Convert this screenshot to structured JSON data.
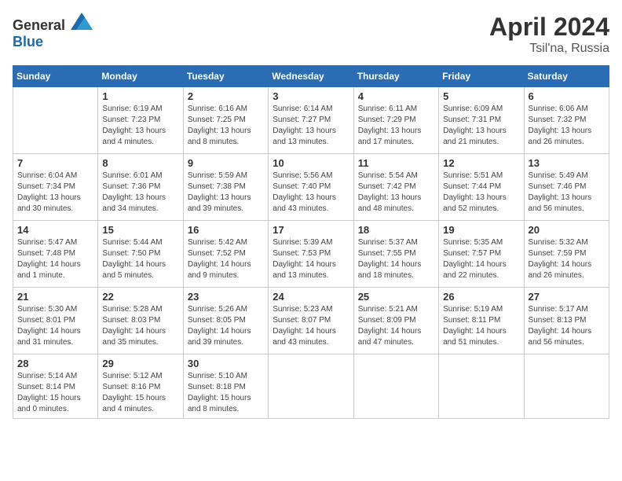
{
  "header": {
    "logo_general": "General",
    "logo_blue": "Blue",
    "month": "April 2024",
    "location": "Tsil'na, Russia"
  },
  "weekdays": [
    "Sunday",
    "Monday",
    "Tuesday",
    "Wednesday",
    "Thursday",
    "Friday",
    "Saturday"
  ],
  "weeks": [
    [
      {
        "day": "",
        "info": ""
      },
      {
        "day": "1",
        "info": "Sunrise: 6:19 AM\nSunset: 7:23 PM\nDaylight: 13 hours\nand 4 minutes."
      },
      {
        "day": "2",
        "info": "Sunrise: 6:16 AM\nSunset: 7:25 PM\nDaylight: 13 hours\nand 8 minutes."
      },
      {
        "day": "3",
        "info": "Sunrise: 6:14 AM\nSunset: 7:27 PM\nDaylight: 13 hours\nand 13 minutes."
      },
      {
        "day": "4",
        "info": "Sunrise: 6:11 AM\nSunset: 7:29 PM\nDaylight: 13 hours\nand 17 minutes."
      },
      {
        "day": "5",
        "info": "Sunrise: 6:09 AM\nSunset: 7:31 PM\nDaylight: 13 hours\nand 21 minutes."
      },
      {
        "day": "6",
        "info": "Sunrise: 6:06 AM\nSunset: 7:32 PM\nDaylight: 13 hours\nand 26 minutes."
      }
    ],
    [
      {
        "day": "7",
        "info": "Sunrise: 6:04 AM\nSunset: 7:34 PM\nDaylight: 13 hours\nand 30 minutes."
      },
      {
        "day": "8",
        "info": "Sunrise: 6:01 AM\nSunset: 7:36 PM\nDaylight: 13 hours\nand 34 minutes."
      },
      {
        "day": "9",
        "info": "Sunrise: 5:59 AM\nSunset: 7:38 PM\nDaylight: 13 hours\nand 39 minutes."
      },
      {
        "day": "10",
        "info": "Sunrise: 5:56 AM\nSunset: 7:40 PM\nDaylight: 13 hours\nand 43 minutes."
      },
      {
        "day": "11",
        "info": "Sunrise: 5:54 AM\nSunset: 7:42 PM\nDaylight: 13 hours\nand 48 minutes."
      },
      {
        "day": "12",
        "info": "Sunrise: 5:51 AM\nSunset: 7:44 PM\nDaylight: 13 hours\nand 52 minutes."
      },
      {
        "day": "13",
        "info": "Sunrise: 5:49 AM\nSunset: 7:46 PM\nDaylight: 13 hours\nand 56 minutes."
      }
    ],
    [
      {
        "day": "14",
        "info": "Sunrise: 5:47 AM\nSunset: 7:48 PM\nDaylight: 14 hours\nand 1 minute."
      },
      {
        "day": "15",
        "info": "Sunrise: 5:44 AM\nSunset: 7:50 PM\nDaylight: 14 hours\nand 5 minutes."
      },
      {
        "day": "16",
        "info": "Sunrise: 5:42 AM\nSunset: 7:52 PM\nDaylight: 14 hours\nand 9 minutes."
      },
      {
        "day": "17",
        "info": "Sunrise: 5:39 AM\nSunset: 7:53 PM\nDaylight: 14 hours\nand 13 minutes."
      },
      {
        "day": "18",
        "info": "Sunrise: 5:37 AM\nSunset: 7:55 PM\nDaylight: 14 hours\nand 18 minutes."
      },
      {
        "day": "19",
        "info": "Sunrise: 5:35 AM\nSunset: 7:57 PM\nDaylight: 14 hours\nand 22 minutes."
      },
      {
        "day": "20",
        "info": "Sunrise: 5:32 AM\nSunset: 7:59 PM\nDaylight: 14 hours\nand 26 minutes."
      }
    ],
    [
      {
        "day": "21",
        "info": "Sunrise: 5:30 AM\nSunset: 8:01 PM\nDaylight: 14 hours\nand 31 minutes."
      },
      {
        "day": "22",
        "info": "Sunrise: 5:28 AM\nSunset: 8:03 PM\nDaylight: 14 hours\nand 35 minutes."
      },
      {
        "day": "23",
        "info": "Sunrise: 5:26 AM\nSunset: 8:05 PM\nDaylight: 14 hours\nand 39 minutes."
      },
      {
        "day": "24",
        "info": "Sunrise: 5:23 AM\nSunset: 8:07 PM\nDaylight: 14 hours\nand 43 minutes."
      },
      {
        "day": "25",
        "info": "Sunrise: 5:21 AM\nSunset: 8:09 PM\nDaylight: 14 hours\nand 47 minutes."
      },
      {
        "day": "26",
        "info": "Sunrise: 5:19 AM\nSunset: 8:11 PM\nDaylight: 14 hours\nand 51 minutes."
      },
      {
        "day": "27",
        "info": "Sunrise: 5:17 AM\nSunset: 8:13 PM\nDaylight: 14 hours\nand 56 minutes."
      }
    ],
    [
      {
        "day": "28",
        "info": "Sunrise: 5:14 AM\nSunset: 8:14 PM\nDaylight: 15 hours\nand 0 minutes."
      },
      {
        "day": "29",
        "info": "Sunrise: 5:12 AM\nSunset: 8:16 PM\nDaylight: 15 hours\nand 4 minutes."
      },
      {
        "day": "30",
        "info": "Sunrise: 5:10 AM\nSunset: 8:18 PM\nDaylight: 15 hours\nand 8 minutes."
      },
      {
        "day": "",
        "info": ""
      },
      {
        "day": "",
        "info": ""
      },
      {
        "day": "",
        "info": ""
      },
      {
        "day": "",
        "info": ""
      }
    ]
  ]
}
